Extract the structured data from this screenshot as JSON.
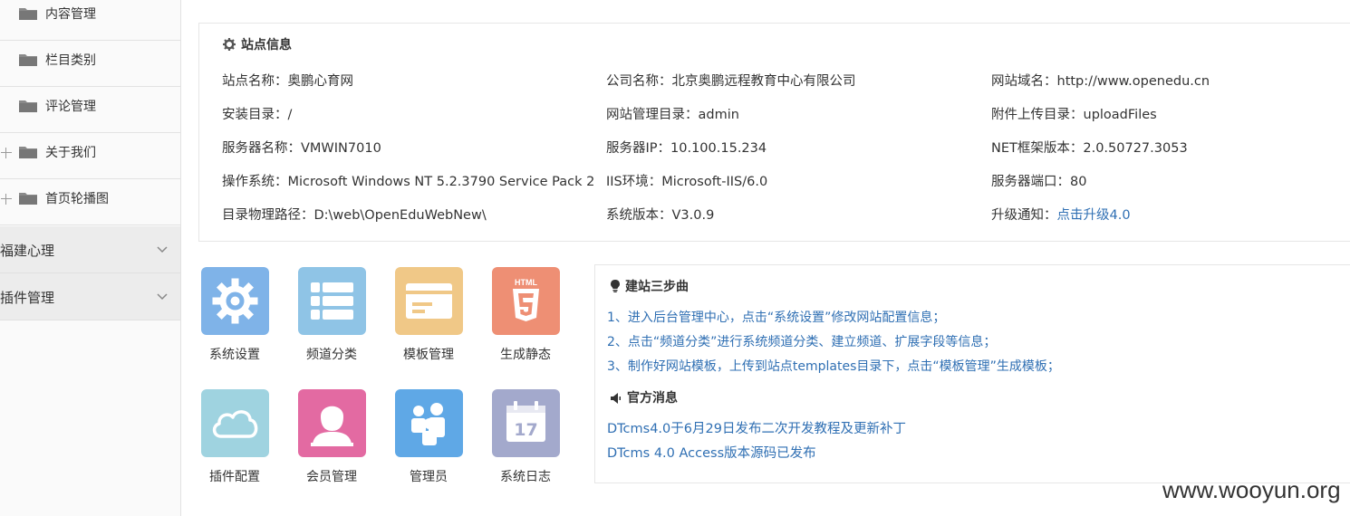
{
  "sidebar": {
    "items": [
      {
        "label": "内容管理",
        "expandable": false
      },
      {
        "label": "栏目类别",
        "expandable": false
      },
      {
        "label": "评论管理",
        "expandable": false
      },
      {
        "label": "关于我们",
        "expandable": true
      },
      {
        "label": "首页轮播图",
        "expandable": true
      }
    ],
    "groups": [
      {
        "label": "福建心理"
      },
      {
        "label": "插件管理"
      }
    ]
  },
  "site_info": {
    "title": "站点信息",
    "rows": [
      [
        "站点名称：奥鹏心育网",
        "公司名称：北京奥鹏远程教育中心有限公司",
        "网站域名：http://www.openedu.cn"
      ],
      [
        "安装目录：/",
        "网站管理目录：admin",
        "附件上传目录：uploadFiles"
      ],
      [
        "服务器名称：VMWIN7010",
        "服务器IP：10.100.15.234",
        "NET框架版本：2.0.50727.3053"
      ],
      [
        "操作系统：Microsoft Windows NT 5.2.3790 Service Pack 2",
        "IIS环境：Microsoft-IIS/6.0",
        "服务器端口：80"
      ],
      [
        "目录物理路径：D:\\web\\OpenEduWebNew\\",
        "系统版本：V3.0.9",
        "升级通知："
      ]
    ],
    "upgrade_link": "点击升级4.0"
  },
  "shortcuts": [
    {
      "label": "系统设置",
      "icon": "gear-icon",
      "color": "#7fb3e8"
    },
    {
      "label": "频道分类",
      "icon": "list-icon",
      "color": "#8fc4e6"
    },
    {
      "label": "模板管理",
      "icon": "template-icon",
      "color": "#f0c887"
    },
    {
      "label": "生成静态",
      "icon": "html5-icon",
      "color": "#ee8f74"
    },
    {
      "label": "插件配置",
      "icon": "cloud-icon",
      "color": "#9fd3e0"
    },
    {
      "label": "会员管理",
      "icon": "user-icon",
      "color": "#e36aa2"
    },
    {
      "label": "管理员",
      "icon": "users-icon",
      "color": "#5fa8e6"
    },
    {
      "label": "系统日志",
      "icon": "calendar-icon",
      "color": "#a3a9cc"
    }
  ],
  "steps": {
    "title": "建站三步曲",
    "items": [
      "1、进入后台管理中心，点击“系统设置”修改网站配置信息；",
      "2、点击“频道分类”进行系统频道分类、建立频道、扩展字段等信息；",
      "3、制作好网站模板，上传到站点templates目录下，点击“模板管理”生成模板；"
    ]
  },
  "news": {
    "title": "官方消息",
    "items": [
      "DTcms4.0于6月29日发布二次开发教程及更新补丁",
      "DTcms 4.0 Access版本源码已发布"
    ]
  },
  "watermark": "www.wooyun.org"
}
